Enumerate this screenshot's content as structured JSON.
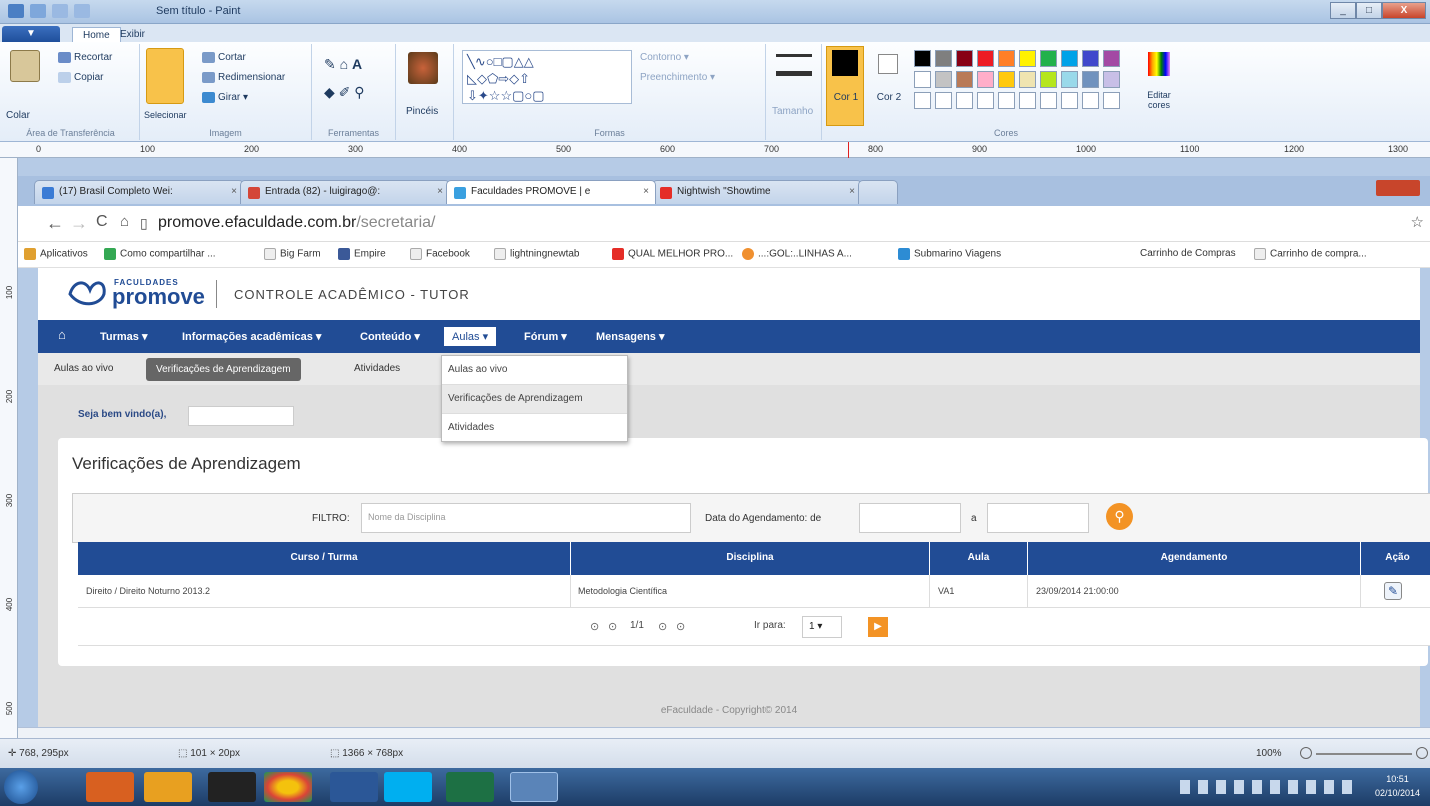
{
  "paint": {
    "title": "Sem título - Paint",
    "tabs": [
      "Home",
      "Exibir"
    ],
    "ribbon": {
      "colar": "Colar",
      "recortar": "Recortar",
      "copiar": "Copiar",
      "transferencia": "Área de Transferência",
      "selecionar": "Selecionar",
      "cortar": "Cortar",
      "redimensionar": "Redimensionar",
      "girar": "Girar",
      "imagem": "Imagem",
      "ferramentas": "Ferramentas",
      "pinceis": "Pincéis",
      "contorno": "Contorno",
      "preenchimento": "Preenchimento",
      "formas": "Formas",
      "tamanho": "Tamanho",
      "cor1": "Cor 1",
      "cor2": "Cor 2",
      "editar_cores": "Editar cores",
      "cores": "Cores"
    },
    "ruler": [
      "0",
      "100",
      "200",
      "300",
      "400",
      "500",
      "600",
      "700",
      "800",
      "900",
      "1000",
      "1100",
      "1200",
      "1300"
    ],
    "vruler": [
      "100",
      "200",
      "300",
      "400",
      "500"
    ],
    "status": {
      "pos": "768, 295px",
      "sel": "101 × 20px",
      "size": "1366 × 768px",
      "zoom": "100%"
    }
  },
  "palette": [
    "#000000",
    "#7f7f7f",
    "#880015",
    "#ed1c24",
    "#ff7f27",
    "#fff200",
    "#22b14c",
    "#00a2e8",
    "#3f48cc",
    "#a349a4",
    "#ffffff",
    "#c3c3c3",
    "#b97a57",
    "#ffaec9",
    "#ffc90e",
    "#efe4b0",
    "#b5e61d",
    "#99d9ea",
    "#7092be",
    "#c8bfe7"
  ],
  "chrome": {
    "tabs": [
      {
        "label": "(17) Brasil Completo Wei:"
      },
      {
        "label": "Entrada (82) - luigirago@:"
      },
      {
        "label": "Faculdades PROMOVE | e"
      },
      {
        "label": "Nightwish \"Showtime"
      }
    ],
    "url_host": "promove.efaculdade.com.br",
    "url_path": "/secretaria/",
    "bookmarks": [
      "Aplicativos",
      "Como compartilhar ...",
      "Big Farm",
      "Empire",
      "Facebook",
      "lightningnewtab",
      "QUAL MELHOR PRO...",
      "...:GOL:..LINHAS A...",
      "Submarino Viagens",
      "Carrinho de Compras",
      "Carrinho de compra..."
    ]
  },
  "site": {
    "logo_top": "FACULDADES",
    "logo": "promove",
    "system": "CONTROLE ACADÊMICO - TUTOR",
    "menu": [
      "Turmas",
      "Informações acadêmicas",
      "Conteúdo",
      "Aulas",
      "Fórum",
      "Mensagens"
    ],
    "submenu": [
      "Aulas ao vivo",
      "Verificações de Aprendizagem",
      "Atividades"
    ],
    "dropdown": [
      "Aulas ao vivo",
      "Verificações de Aprendizagem",
      "Atividades"
    ],
    "welcome": "Seja bem vindo(a),",
    "panel_title": "Verificações de Aprendizagem",
    "filter_label": "FILTRO:",
    "filter_placeholder": "Nome da Disciplina",
    "date_label": "Data do Agendamento: de",
    "date_to": "a",
    "table": {
      "headers": [
        "Curso / Turma",
        "Disciplina",
        "Aula",
        "Agendamento",
        "Ação"
      ],
      "rows": [
        [
          "Direito / Direito Noturno 2013.2",
          "Metodologia Científica",
          "VA1",
          "23/09/2014 21:00:00"
        ]
      ]
    },
    "pager": {
      "text": "1/1",
      "goto": "Ir para:",
      "page": "1"
    },
    "footer": "eFaculdade - Copyright© 2014"
  },
  "taskbar": {
    "time": "10:51",
    "date": "02/10/2014"
  }
}
